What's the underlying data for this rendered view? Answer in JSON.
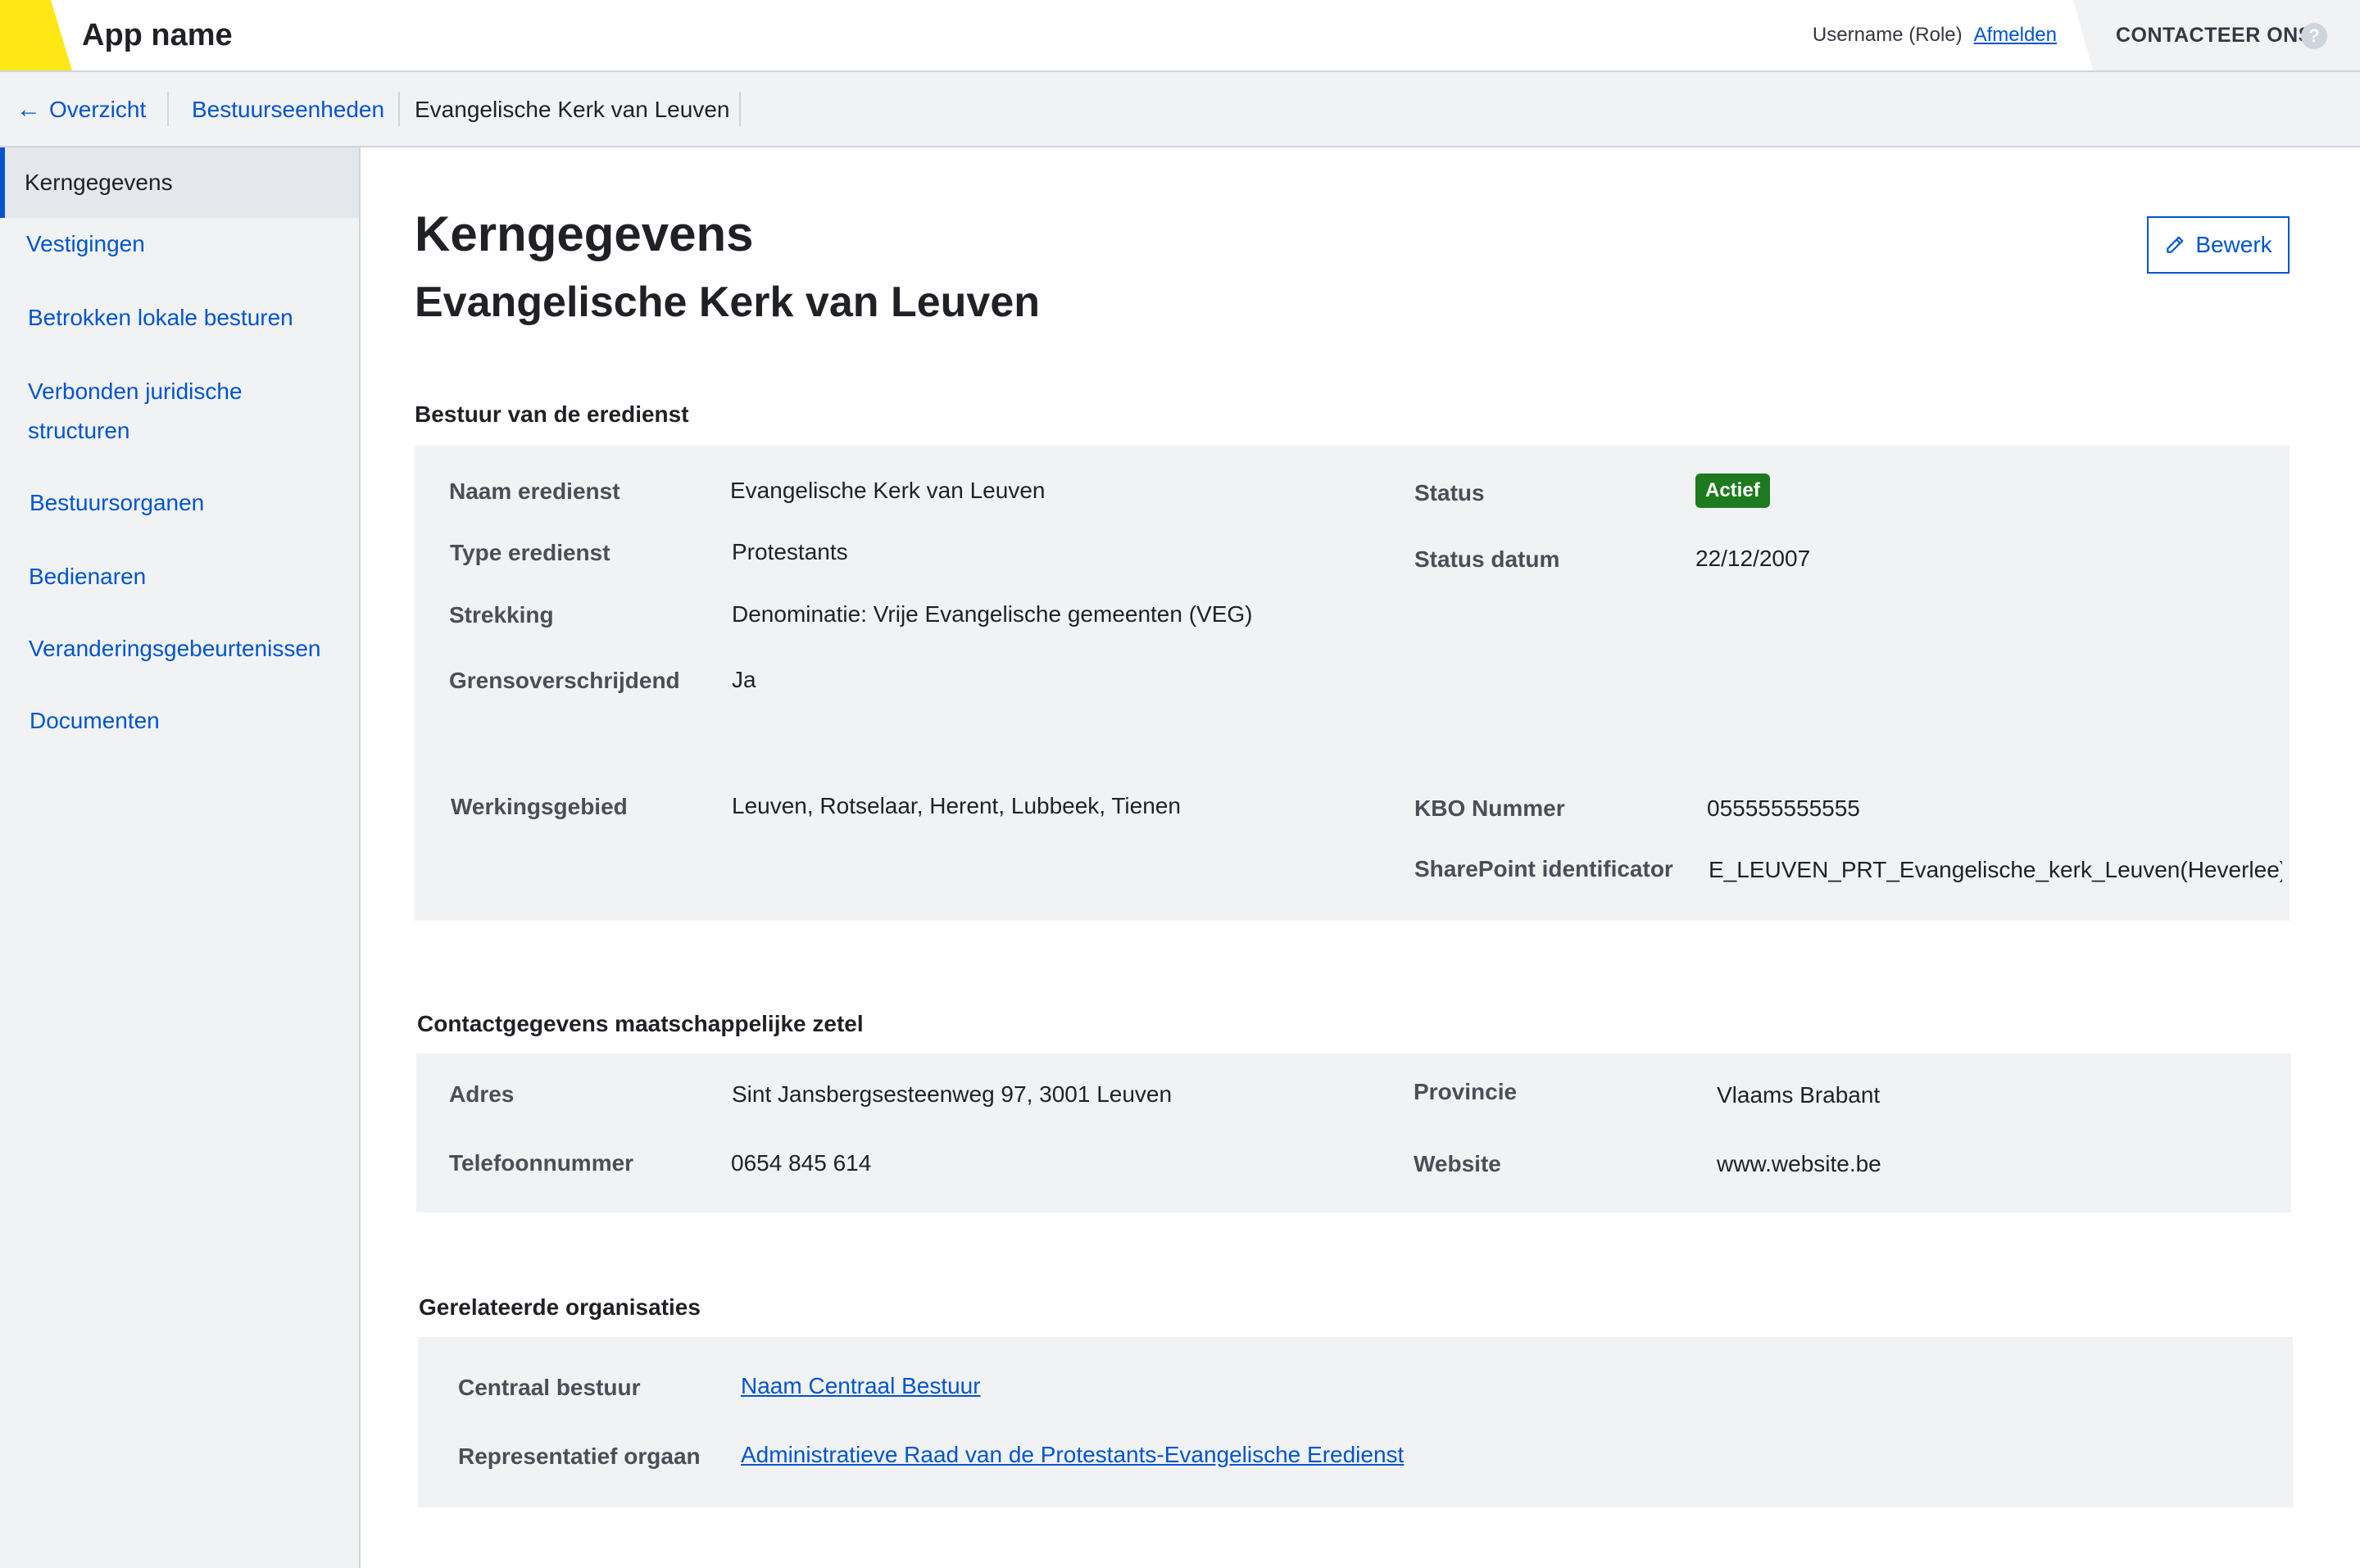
{
  "header": {
    "app_name": "App name",
    "username": "Username (Role)",
    "logout_label": "Afmelden",
    "contact_label": "CONTACTEER ONS",
    "help_symbol": "?"
  },
  "breadcrumb": {
    "back_label": "Overzicht",
    "back_arrow": "←",
    "items": [
      "Bestuurseenheden",
      "Evangelische Kerk van Leuven"
    ]
  },
  "sidebar": {
    "items": [
      {
        "label": "Kerngegevens",
        "active": true
      },
      {
        "label": "Vestigingen"
      },
      {
        "label": "Betrokken lokale besturen"
      },
      {
        "label": "Verbonden juridische structuren"
      },
      {
        "label": "Bestuursorganen"
      },
      {
        "label": "Bedienaren"
      },
      {
        "label": "Veranderingsgebeurtenissen"
      },
      {
        "label": "Documenten"
      }
    ]
  },
  "main": {
    "title": "Kerngegevens",
    "subtitle": "Evangelische Kerk van Leuven",
    "edit_label": "Bewerk"
  },
  "section1": {
    "title": "Bestuur van de eredienst",
    "naam_label": "Naam eredienst",
    "naam_value": "Evangelische Kerk van Leuven",
    "type_label": "Type eredienst",
    "type_value": "Protestants",
    "strekking_label": "Strekking",
    "strekking_value": "Denominatie: Vrije Evangelische gemeenten (VEG)",
    "grens_label": "Grensoverschrijdend",
    "grens_value": "Ja",
    "werking_label": "Werkingsgebied",
    "werking_value": "Leuven, Rotselaar, Herent, Lubbeek, Tienen",
    "status_label": "Status",
    "status_value": "Actief",
    "status_color": "#1e7a1e",
    "statusdatum_label": "Status datum",
    "statusdatum_value": "22/12/2007",
    "kbo_label": "KBO Nummer",
    "kbo_value": "055555555555",
    "sharepoint_label": "SharePoint identificator",
    "sharepoint_value": "E_LEUVEN_PRT_Evangelische_kerk_Leuven(Heverlee)_V"
  },
  "section2": {
    "title": "Contactgegevens maatschappelijke zetel",
    "adres_label": "Adres",
    "adres_value": "Sint Jansbergsesteenweg 97, 3001 Leuven",
    "telefoon_label": "Telefoonnummer",
    "telefoon_value": "0654 845 614",
    "provincie_label": "Provincie",
    "provincie_value": "Vlaams Brabant",
    "website_label": "Website",
    "website_value": "www.website.be"
  },
  "section3": {
    "title": "Gerelateerde organisaties",
    "centraal_label": "Centraal bestuur",
    "centraal_value": "Naam Centraal Bestuur",
    "repr_label": "Representatief orgaan",
    "repr_value": "Administratieve Raad van de Protestants-Evangelische Eredienst"
  },
  "colors": {
    "accent": "#0055cc",
    "brand_yellow": "#ffe615",
    "panel_bg": "#f1f2f4"
  },
  "icons": {
    "edit": "pencil-icon",
    "back": "arrow-left-icon",
    "help": "question-circle-icon"
  }
}
